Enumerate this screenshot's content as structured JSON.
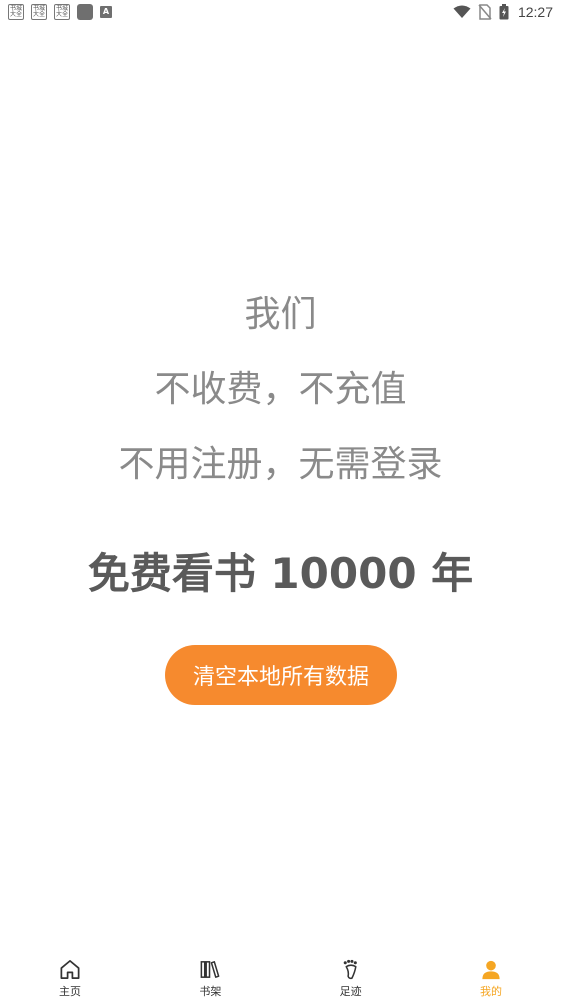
{
  "status_bar": {
    "notification_icons": [
      {
        "icon": "app-notification-icon",
        "text": "书城大全"
      },
      {
        "icon": "app-notification-icon",
        "text": "书城大全"
      },
      {
        "icon": "app-notification-icon",
        "text": "书城大全"
      }
    ],
    "time": "12:27"
  },
  "main": {
    "line1": "我们",
    "line2": "不收费，不充值",
    "line3": "不用注册，无需登录",
    "headline": "免费看书 10000 年",
    "clear_button": "清空本地所有数据"
  },
  "bottom_nav": {
    "items": [
      {
        "label": "主页",
        "icon": "home-icon"
      },
      {
        "label": "书架",
        "icon": "bookshelf-icon"
      },
      {
        "label": "足迹",
        "icon": "footprint-icon"
      },
      {
        "label": "我的",
        "icon": "user-icon"
      }
    ],
    "active_index": 3,
    "active_color": "#f5a623"
  },
  "colors": {
    "accent": "#f68a2e",
    "text_gray": "#8a8a8a"
  }
}
